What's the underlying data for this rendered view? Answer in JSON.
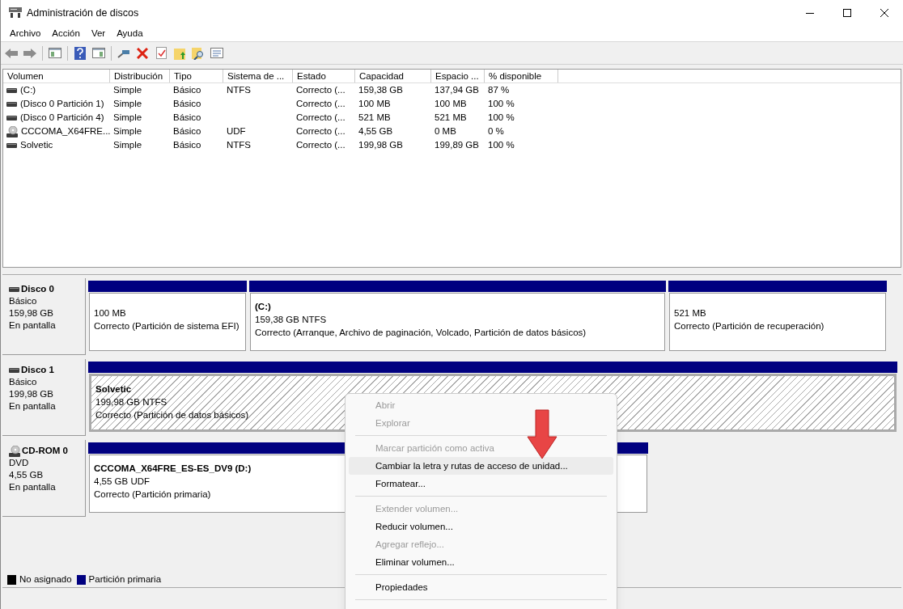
{
  "window": {
    "title": "Administración de discos"
  },
  "menu": [
    "Archivo",
    "Acción",
    "Ver",
    "Ayuda"
  ],
  "table": {
    "columns": [
      "Volumen",
      "Distribución",
      "Tipo",
      "Sistema de ...",
      "Estado",
      "Capacidad",
      "Espacio ...",
      "% disponible"
    ],
    "rows": [
      {
        "kind": "disk",
        "cells": [
          "(C:)",
          "Simple",
          "Básico",
          "NTFS",
          "Correcto (...",
          "159,38 GB",
          "137,94 GB",
          "87 %"
        ]
      },
      {
        "kind": "disk",
        "cells": [
          "(Disco 0 Partición 1)",
          "Simple",
          "Básico",
          "",
          "Correcto (...",
          "100 MB",
          "100 MB",
          "100 %"
        ]
      },
      {
        "kind": "disk",
        "cells": [
          "(Disco 0 Partición 4)",
          "Simple",
          "Básico",
          "",
          "Correcto (...",
          "521 MB",
          "521 MB",
          "100 %"
        ]
      },
      {
        "kind": "cdrom",
        "cells": [
          "CCCOMA_X64FRE...",
          "Simple",
          "Básico",
          "UDF",
          "Correcto (...",
          "4,55 GB",
          "0 MB",
          "0 %"
        ]
      },
      {
        "kind": "disk",
        "cells": [
          "Solvetic",
          "Simple",
          "Básico",
          "NTFS",
          "Correcto (...",
          "199,98 GB",
          "199,89 GB",
          "100 %"
        ]
      }
    ]
  },
  "disks": [
    {
      "kind": "disk",
      "name": "Disco 0",
      "type": "Básico",
      "size": "159,98 GB",
      "status": "En pantalla",
      "partitions": [
        {
          "size": "100 MB",
          "status": "Correcto (Partición de sistema EFI)",
          "selected": false
        },
        {
          "name": "(C:)",
          "size": "159,38 GB NTFS",
          "status": "Correcto (Arranque, Archivo de paginación, Volcado, Partición de datos básicos)",
          "selected": false
        },
        {
          "size": "521 MB",
          "status": "Correcto (Partición de recuperación)",
          "selected": false
        }
      ]
    },
    {
      "kind": "disk",
      "name": "Disco 1",
      "type": "Básico",
      "size": "199,98 GB",
      "status": "En pantalla",
      "partitions": [
        {
          "name": "Solvetic",
          "size": "199,98 GB NTFS",
          "status": "Correcto (Partición de datos básicos)",
          "selected": true
        }
      ]
    },
    {
      "kind": "cdrom",
      "name": "CD-ROM 0",
      "type": "DVD",
      "size": "4,55 GB",
      "status": "En pantalla",
      "partitions": [
        {
          "name": "CCCOMA_X64FRE_ES-ES_DV9  (D:)",
          "size": "4,55 GB UDF",
          "status": "Correcto (Partición primaria)",
          "selected": false
        }
      ]
    }
  ],
  "legend": [
    {
      "label": "No asignado",
      "color": "#000000"
    },
    {
      "label": "Partición primaria",
      "color": "#000080"
    }
  ],
  "context_menu": [
    {
      "kind": "item",
      "label": "Abrir",
      "disabled": true,
      "selected": false
    },
    {
      "kind": "item",
      "label": "Explorar",
      "disabled": true,
      "selected": false
    },
    {
      "kind": "separator"
    },
    {
      "kind": "item",
      "label": "Marcar partición como activa",
      "disabled": true,
      "selected": false
    },
    {
      "kind": "item",
      "label": "Cambiar la letra y rutas de acceso de unidad...",
      "disabled": false,
      "selected": true
    },
    {
      "kind": "item",
      "label": "Formatear...",
      "disabled": false,
      "selected": false
    },
    {
      "kind": "separator"
    },
    {
      "kind": "item",
      "label": "Extender volumen...",
      "disabled": true,
      "selected": false
    },
    {
      "kind": "item",
      "label": "Reducir volumen...",
      "disabled": false,
      "selected": false
    },
    {
      "kind": "item",
      "label": "Agregar reflejo...",
      "disabled": true,
      "selected": false
    },
    {
      "kind": "item",
      "label": "Eliminar volumen...",
      "disabled": false,
      "selected": false
    },
    {
      "kind": "separator"
    },
    {
      "kind": "item",
      "label": "Propiedades",
      "disabled": false,
      "selected": false
    },
    {
      "kind": "separator"
    }
  ]
}
